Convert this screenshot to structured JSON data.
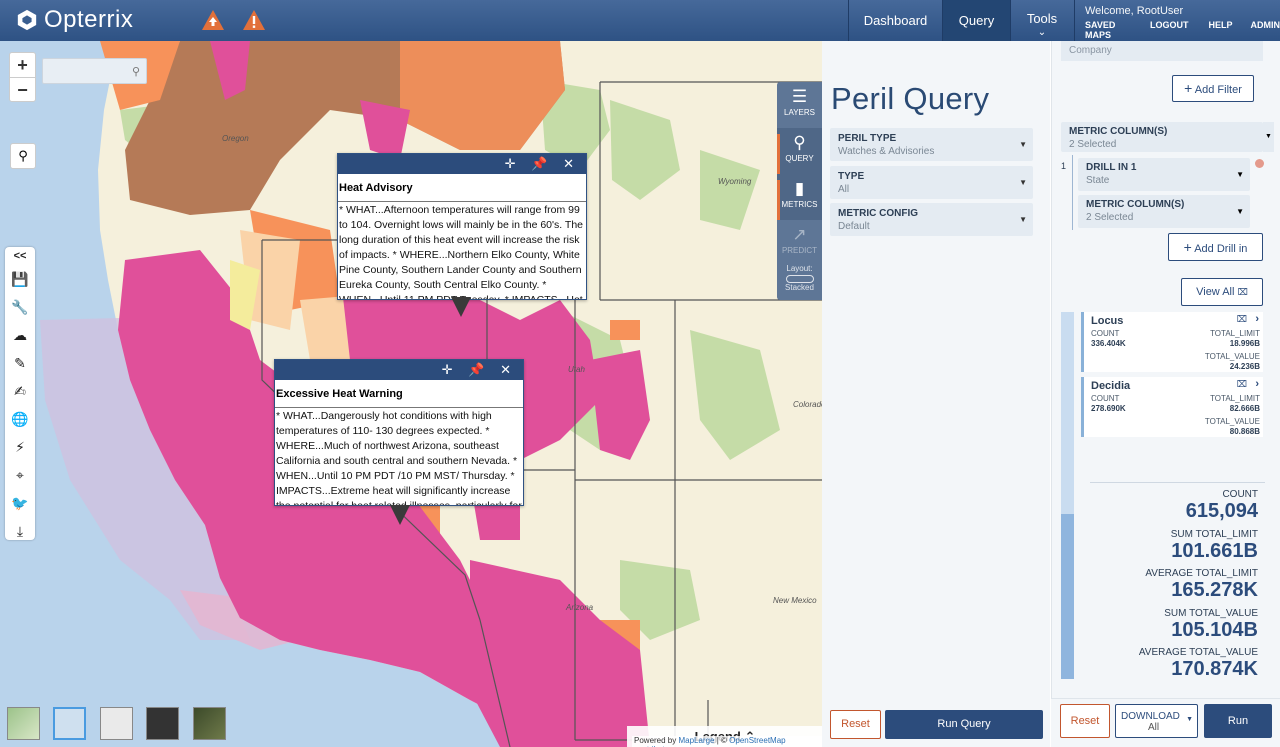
{
  "app": {
    "name": "Opterrix"
  },
  "nav": {
    "dashboard": "Dashboard",
    "query": "Query",
    "tools": "Tools",
    "tools_caret": "⌄"
  },
  "user": {
    "welcome": "Welcome, RootUser",
    "links": [
      "SAVED MAPS",
      "LOGOUT",
      "HELP",
      "ADMIN"
    ]
  },
  "map": {
    "zoom_in": "+",
    "zoom_out": "−",
    "search_placeholder": "",
    "collapse_label": "<<",
    "tools": [
      "save-icon",
      "wrench-icon",
      "cloud-upload-icon",
      "draw-icon",
      "edit-icon",
      "globe-icon",
      "lightning-icon",
      "crosshair-icon",
      "twitter-icon",
      "download-icon"
    ],
    "labels": {
      "oregon": "Oregon",
      "wyoming": "Wyoming",
      "colorado": "Colorado",
      "new_mexico": "New Mexico",
      "arizona": "Arizona",
      "utah": "Utah"
    },
    "popups": [
      {
        "title": "Heat Advisory",
        "body": "* WHAT...Afternoon temperatures will range from 99 to 104. Overnight lows will mainly be in the 60's. The long duration of this heat event will increase the risk of impacts. * WHERE...Northern Elko County, White Pine County, Southern Lander County and Southern Eureka County, South Central Elko County. * WHEN...Until 11 PM PDT Tuesday. * IMPACTS...Hot temperatures"
      },
      {
        "title": "Excessive Heat Warning",
        "body": "* WHAT...Dangerously hot conditions with high temperatures of 110- 130 degrees expected. * WHERE...Much of northwest Arizona, southeast California and south central and southern Nevada. * WHEN...Until 10 PM PDT /10 PM MST/ Thursday. * IMPACTS...Extreme heat will significantly increase the potential for heat related illnesses, particularly for those"
      }
    ],
    "popup_controls": "✛ 📌 ✕",
    "legend": "Legend ⌃",
    "attribution": {
      "prefix": "Powered by ",
      "maplarge": "MapLarge",
      "sep": " | © ",
      "osm": "OpenStreetMap contributors"
    }
  },
  "query_nav": [
    {
      "label": "LAYERS",
      "icon": "layers-icon"
    },
    {
      "label": "QUERY",
      "icon": "query-icon"
    },
    {
      "label": "METRICS",
      "icon": "metrics-icon"
    },
    {
      "label": "PREDICT",
      "icon": "predict-icon"
    }
  ],
  "layout_label": "Layout:",
  "layout_value": "Stacked",
  "peril_query": {
    "title": "Peril Query",
    "fields": [
      {
        "label": "PERIL TYPE",
        "value": "Watches & Advisories"
      },
      {
        "label": "TYPE",
        "value": "All"
      },
      {
        "label": "METRIC CONFIG",
        "value": "Default"
      }
    ],
    "reset": "Reset",
    "run_query": "Run Query"
  },
  "metrics": {
    "company_value": "Company",
    "add_filter": "Add Filter",
    "metric_columns": {
      "label": "METRIC COLUMN(S)",
      "value": "2 Selected"
    },
    "drill_index": "1",
    "drill": {
      "label": "DRILL IN 1",
      "value": "State"
    },
    "drill_metric": {
      "label": "METRIC COLUMN(S)",
      "value": "2 Selected"
    },
    "add_drill": "Add Drill in",
    "view_all": "View All",
    "cards": [
      {
        "name": "Locus",
        "count_label": "COUNT",
        "count": "336.404K",
        "limit_label": "TOTAL_LIMIT",
        "limit": "18.996B",
        "value_label": "TOTAL_VALUE",
        "value": "24.236B"
      },
      {
        "name": "Decidia",
        "count_label": "COUNT",
        "count": "278.690K",
        "limit_label": "TOTAL_LIMIT",
        "limit": "82.666B",
        "value_label": "TOTAL_VALUE",
        "value": "80.868B"
      }
    ],
    "summary": [
      {
        "label": "COUNT",
        "value": "615,094"
      },
      {
        "label": "SUM TOTAL_LIMIT",
        "value": "101.661B"
      },
      {
        "label": "AVERAGE TOTAL_LIMIT",
        "value": "165.278K"
      },
      {
        "label": "SUM TOTAL_VALUE",
        "value": "105.104B"
      },
      {
        "label": "AVERAGE TOTAL_VALUE",
        "value": "170.874K"
      }
    ],
    "reset": "Reset",
    "download": "DOWNLOAD",
    "download_sub": "All",
    "run": "Run"
  },
  "colors": {
    "brand": "#2c4c7c",
    "accent": "#c2562e",
    "pink": "#e0509a",
    "orange": "#f7925a",
    "brown": "#b57a57"
  }
}
